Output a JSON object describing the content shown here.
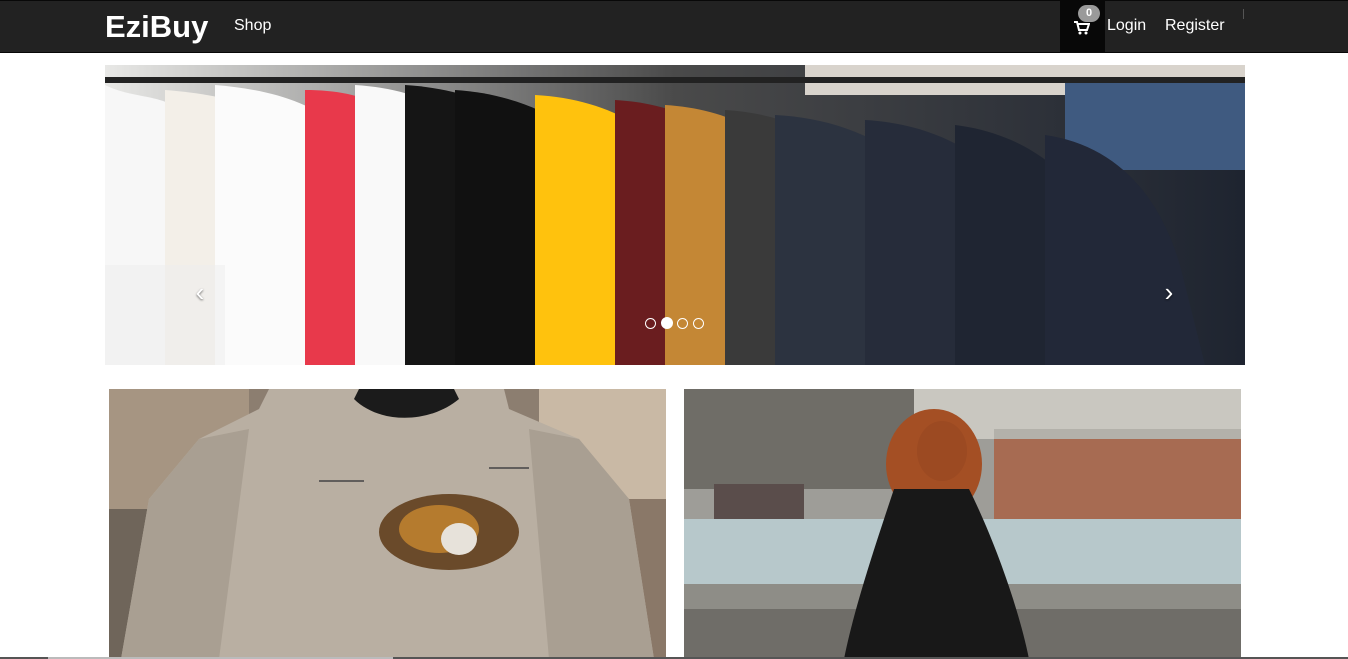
{
  "navbar": {
    "brand": "EziBuy",
    "shop_label": "Shop",
    "cart_count": "0",
    "login_label": "Login",
    "register_label": "Register"
  },
  "carousel": {
    "prev_glyph": "‹",
    "next_glyph": "›",
    "slide_count": 4,
    "active_index": 1
  },
  "colors": {
    "navbar_bg": "#222222",
    "cart_bg": "#080808",
    "badge_bg": "#9a9a9a"
  },
  "icons": [
    "cart-icon",
    "chevron-left-icon",
    "chevron-right-icon"
  ]
}
